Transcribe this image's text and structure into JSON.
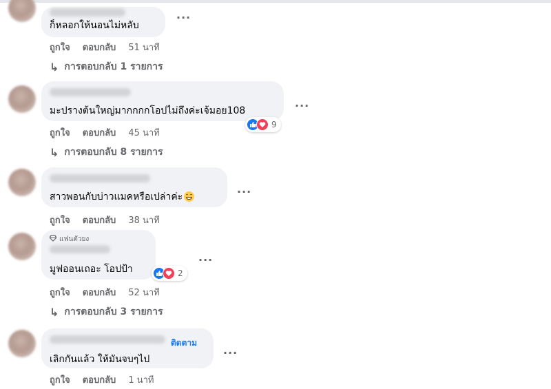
{
  "ui": {
    "more_glyph": "...",
    "like_label": "ถูกใจ",
    "reply_label": "ตอบกลับ",
    "reply_arrow": "↳",
    "colors": {
      "accent": "#1877f2",
      "love": "#f33e58",
      "bubble": "#f0f2f5",
      "meta": "#65676b"
    }
  },
  "comments": [
    {
      "text": "ก็หลอกให้นอนไม่หลับ",
      "time": "51 นาที",
      "replies": "การตอบกลับ 1 รายการ"
    },
    {
      "text": "มะปรางต้นใหญ่มากกกกโอปไม่ถึงค่ะเจ้มอย108",
      "time": "45 นาที",
      "reaction_count": "9",
      "replies": "การตอบกลับ 8 รายการ"
    },
    {
      "text": "สาวพอนกับบ่าวแมคหรือเปล่าค่ะ",
      "emoji": "grinning-face",
      "time": "38 นาที"
    },
    {
      "badge": "แฟนตัวยง",
      "text": "มูฟออนเถอะ โอปป้า",
      "time": "52 นาที",
      "reaction_count": "2",
      "replies": "การตอบกลับ 3 รายการ"
    },
    {
      "follow": "ติดตาม",
      "text": "เลิกกันแล้ว ให้มันจบๆไป",
      "time": "1 นาที"
    }
  ]
}
